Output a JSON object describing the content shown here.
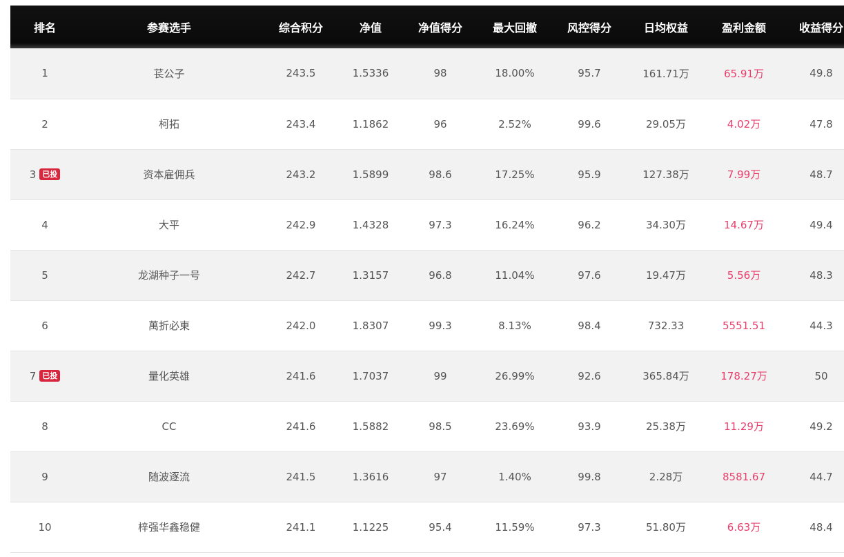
{
  "headers": [
    "排名",
    "参赛选手",
    "综合积分",
    "净值",
    "净值得分",
    "最大回撤",
    "风控得分",
    "日均权益",
    "盈利金额",
    "收益得分"
  ],
  "badge_label": "已投",
  "colors": {
    "header_bg": "#0d0d0d",
    "profit": "#e83e6c",
    "badge": "#d7263d",
    "row_alt": "#f2f2f2"
  },
  "rows": [
    {
      "rank": "1",
      "badge": false,
      "player": "苌公子",
      "score": "243.5",
      "nav": "1.5336",
      "nav_score": "98",
      "drawdown": "18.00%",
      "risk_score": "95.7",
      "avg_equity": "161.71万",
      "profit": "65.91万",
      "return_score": "49.8"
    },
    {
      "rank": "2",
      "badge": false,
      "player": "柯拓",
      "score": "243.4",
      "nav": "1.1862",
      "nav_score": "96",
      "drawdown": "2.52%",
      "risk_score": "99.6",
      "avg_equity": "29.05万",
      "profit": "4.02万",
      "return_score": "47.8"
    },
    {
      "rank": "3",
      "badge": true,
      "player": "资本雇佣兵",
      "score": "243.2",
      "nav": "1.5899",
      "nav_score": "98.6",
      "drawdown": "17.25%",
      "risk_score": "95.9",
      "avg_equity": "127.38万",
      "profit": "7.99万",
      "return_score": "48.7"
    },
    {
      "rank": "4",
      "badge": false,
      "player": "大平",
      "score": "242.9",
      "nav": "1.4328",
      "nav_score": "97.3",
      "drawdown": "16.24%",
      "risk_score": "96.2",
      "avg_equity": "34.30万",
      "profit": "14.67万",
      "return_score": "49.4"
    },
    {
      "rank": "5",
      "badge": false,
      "player": "龙湖种子一号",
      "score": "242.7",
      "nav": "1.3157",
      "nav_score": "96.8",
      "drawdown": "11.04%",
      "risk_score": "97.6",
      "avg_equity": "19.47万",
      "profit": "5.56万",
      "return_score": "48.3"
    },
    {
      "rank": "6",
      "badge": false,
      "player": "萬折必東",
      "score": "242.0",
      "nav": "1.8307",
      "nav_score": "99.3",
      "drawdown": "8.13%",
      "risk_score": "98.4",
      "avg_equity": "732.33",
      "profit": "5551.51",
      "return_score": "44.3"
    },
    {
      "rank": "7",
      "badge": true,
      "player": "量化英雄",
      "score": "241.6",
      "nav": "1.7037",
      "nav_score": "99",
      "drawdown": "26.99%",
      "risk_score": "92.6",
      "avg_equity": "365.84万",
      "profit": "178.27万",
      "return_score": "50"
    },
    {
      "rank": "8",
      "badge": false,
      "player": "CC",
      "score": "241.6",
      "nav": "1.5882",
      "nav_score": "98.5",
      "drawdown": "23.69%",
      "risk_score": "93.9",
      "avg_equity": "25.38万",
      "profit": "11.29万",
      "return_score": "49.2"
    },
    {
      "rank": "9",
      "badge": false,
      "player": "随波逐流",
      "score": "241.5",
      "nav": "1.3616",
      "nav_score": "97",
      "drawdown": "1.40%",
      "risk_score": "99.8",
      "avg_equity": "2.28万",
      "profit": "8581.67",
      "return_score": "44.7"
    },
    {
      "rank": "10",
      "badge": false,
      "player": "梓强华鑫稳健",
      "score": "241.1",
      "nav": "1.1225",
      "nav_score": "95.4",
      "drawdown": "11.59%",
      "risk_score": "97.3",
      "avg_equity": "51.80万",
      "profit": "6.63万",
      "return_score": "48.4"
    }
  ]
}
